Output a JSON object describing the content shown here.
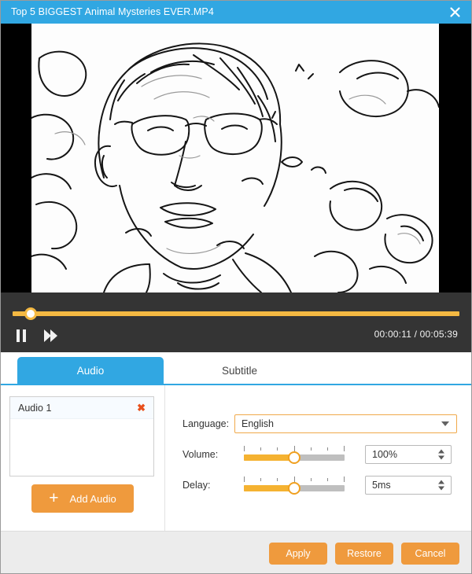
{
  "window": {
    "title": "Top 5 BIGGEST Animal Mysteries EVER.MP4",
    "close_label": "close-window",
    "titlebar_color": "#31a7e2"
  },
  "player": {
    "current_time": "00:00:11",
    "total_time": "00:05:39",
    "time_separator": "/",
    "time_readout": "00:00:11 / 00:05:39",
    "progress_percent": 4,
    "pause_label": "Pause",
    "forward_label": "Fast Forward",
    "accent_color": "#f4b942",
    "background_color": "#343434"
  },
  "tabs": [
    {
      "id": "audio",
      "label": "Audio",
      "active": true
    },
    {
      "id": "subtitle",
      "label": "Subtitle",
      "active": false
    }
  ],
  "audio_panel": {
    "tracks": [
      {
        "label": "Audio 1",
        "remove_icon": "✖"
      }
    ],
    "add_button_label": "Add Audio",
    "add_button_icon": "+",
    "language": {
      "label": "Language:",
      "value": "English",
      "options": [
        "English"
      ]
    },
    "volume": {
      "label": "Volume:",
      "value": "100%",
      "slider_percent": 50
    },
    "delay": {
      "label": "Delay:",
      "value": "5ms",
      "slider_percent": 50
    }
  },
  "footer": {
    "buttons": [
      {
        "id": "apply",
        "label": "Apply"
      },
      {
        "id": "restore",
        "label": "Restore"
      },
      {
        "id": "cancel",
        "label": "Cancel"
      }
    ],
    "button_color": "#ef9a3d"
  }
}
